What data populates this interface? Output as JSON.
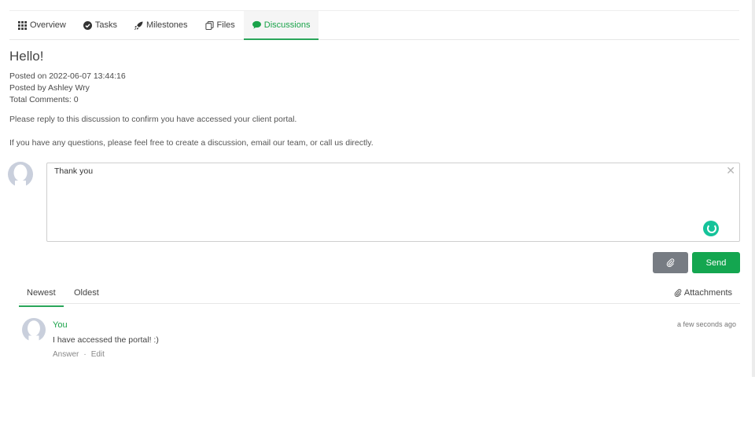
{
  "tabs": [
    {
      "label": "Overview",
      "icon": "grid-icon",
      "active": false
    },
    {
      "label": "Tasks",
      "icon": "check-circle-icon",
      "active": false
    },
    {
      "label": "Milestones",
      "icon": "rocket-icon",
      "active": false
    },
    {
      "label": "Files",
      "icon": "files-icon",
      "active": false
    },
    {
      "label": "Discussions",
      "icon": "chat-bubble-icon",
      "active": true
    }
  ],
  "discussion": {
    "title": "Hello!",
    "posted_on": "Posted on 2022-06-07 13:44:16",
    "posted_by": "Posted by Ashley Wry",
    "total_comments": "Total Comments: 0",
    "body_line1": "Please reply to this discussion to confirm you have accessed your client portal.",
    "body_line2": "If you have any questions, please feel free to create a discussion, email our team, or call us directly."
  },
  "compose": {
    "value": "Thank you",
    "close_label": "✕",
    "send_label": "Send",
    "attach_icon": "paperclip-icon"
  },
  "sort": {
    "newest": "Newest",
    "oldest": "Oldest",
    "attachments": "Attachments"
  },
  "comments": [
    {
      "author": "You",
      "text": "I have accessed the portal! :)",
      "answer": "Answer",
      "separator": "·",
      "edit": "Edit",
      "time": "a few seconds ago"
    }
  ],
  "colors": {
    "accent": "#14a650",
    "attach_button": "#777c83",
    "grammarly": "#15c39a"
  }
}
